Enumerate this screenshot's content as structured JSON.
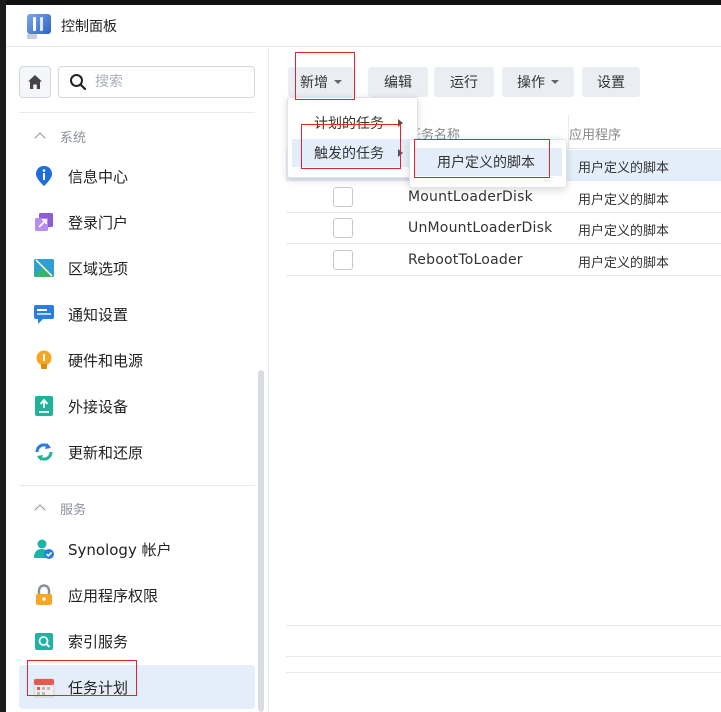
{
  "window": {
    "title": "控制面板"
  },
  "sidebar": {
    "search_placeholder": "搜索",
    "sections": [
      {
        "label": "系统"
      },
      {
        "label": "服务"
      }
    ],
    "items": [
      {
        "label": "信息中心"
      },
      {
        "label": "登录门户"
      },
      {
        "label": "区域选项"
      },
      {
        "label": "通知设置"
      },
      {
        "label": "硬件和电源"
      },
      {
        "label": "外接设备"
      },
      {
        "label": "更新和还原"
      },
      {
        "label": "Synology 帐户"
      },
      {
        "label": "应用程序权限"
      },
      {
        "label": "索引服务"
      },
      {
        "label": "任务计划"
      }
    ]
  },
  "toolbar": {
    "create": "新增",
    "edit": "编辑",
    "run": "运行",
    "action": "操作",
    "settings": "设置"
  },
  "create_menu": {
    "items": [
      {
        "label": "计划的任务"
      },
      {
        "label": "触发的任务"
      }
    ],
    "submenu": {
      "items": [
        {
          "label": "用户定义的脚本"
        }
      ]
    }
  },
  "table": {
    "columns": {
      "name": "任务名称",
      "app": "应用程序"
    },
    "rows": [
      {
        "name": "",
        "app": "用户定义的脚本"
      },
      {
        "name": "MountLoaderDisk",
        "app": "用户定义的脚本"
      },
      {
        "name": "UnMountLoaderDisk",
        "app": "用户定义的脚本"
      },
      {
        "name": "RebootToLoader",
        "app": "用户定义的脚本"
      }
    ]
  },
  "colors": {
    "accent": "#0086e5",
    "selection": "#e4eefa",
    "highlight_box": "#e2242b"
  }
}
